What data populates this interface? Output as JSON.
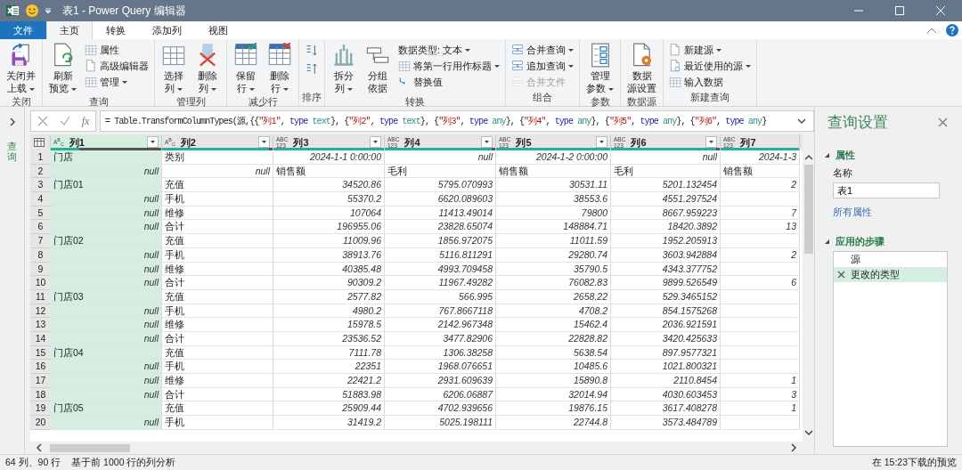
{
  "window": {
    "title": "表1 - Power Query 编辑器"
  },
  "tabs": [
    {
      "label": "文件",
      "kind": "file",
      "selected": false
    },
    {
      "label": "主页",
      "kind": "tab",
      "selected": true
    },
    {
      "label": "转换",
      "kind": "tab",
      "selected": false
    },
    {
      "label": "添加列",
      "kind": "tab",
      "selected": false
    },
    {
      "label": "视图",
      "kind": "tab",
      "selected": false
    }
  ],
  "ribbon": [
    {
      "label": "关闭",
      "items": [
        {
          "kind": "large",
          "lines": [
            "关闭并",
            "上载"
          ],
          "dropdown": true,
          "disabled": false
        }
      ]
    },
    {
      "label": "查询",
      "items": [
        {
          "kind": "large",
          "lines": [
            "刷新",
            "预览"
          ],
          "dropdown": true,
          "disabled": false
        },
        {
          "kind": "small",
          "lines": [
            "属性"
          ],
          "dropdown": false,
          "disabled": false
        },
        {
          "kind": "small",
          "lines": [
            "高级编辑器"
          ],
          "dropdown": false,
          "disabled": false
        },
        {
          "kind": "small",
          "lines": [
            "管理"
          ],
          "dropdown": true,
          "disabled": false
        }
      ]
    },
    {
      "label": "管理列",
      "items": [
        {
          "kind": "large",
          "lines": [
            "选择",
            "列"
          ],
          "dropdown": true,
          "disabled": false
        },
        {
          "kind": "large",
          "lines": [
            "删除",
            "列"
          ],
          "dropdown": true,
          "disabled": false
        }
      ]
    },
    {
      "label": "减少行",
      "items": [
        {
          "kind": "large",
          "lines": [
            "保留",
            "行"
          ],
          "dropdown": true,
          "disabled": false
        },
        {
          "kind": "large",
          "lines": [
            "删除",
            "行"
          ],
          "dropdown": true,
          "disabled": false
        }
      ]
    },
    {
      "label": "排序",
      "items": [
        {
          "kind": "icon",
          "disabled": false
        },
        {
          "kind": "icon",
          "disabled": false
        }
      ]
    },
    {
      "label": "转换",
      "items": [
        {
          "kind": "large",
          "lines": [
            "拆分",
            "列"
          ],
          "dropdown": true,
          "disabled": false
        },
        {
          "kind": "large",
          "lines": [
            "分组",
            "依据"
          ],
          "dropdown": false,
          "disabled": false
        },
        {
          "kind": "small",
          "lines": [
            "数据类型: 文本"
          ],
          "dropdown": true,
          "disabled": false
        },
        {
          "kind": "small",
          "lines": [
            "将第一行用作标题"
          ],
          "dropdown": true,
          "disabled": false
        },
        {
          "kind": "small",
          "lines": [
            "替换值"
          ],
          "dropdown": false,
          "disabled": false
        }
      ]
    },
    {
      "label": "组合",
      "items": [
        {
          "kind": "small",
          "lines": [
            "合并查询"
          ],
          "dropdown": true,
          "disabled": false
        },
        {
          "kind": "small",
          "lines": [
            "追加查询"
          ],
          "dropdown": true,
          "disabled": false
        },
        {
          "kind": "small",
          "lines": [
            "合并文件"
          ],
          "dropdown": false,
          "disabled": true
        }
      ]
    },
    {
      "label": "参数",
      "items": [
        {
          "kind": "large",
          "lines": [
            "管理",
            "参数"
          ],
          "dropdown": true,
          "disabled": false
        }
      ]
    },
    {
      "label": "数据源",
      "items": [
        {
          "kind": "large",
          "lines": [
            "数据",
            "源设置"
          ],
          "dropdown": false,
          "disabled": false
        }
      ]
    },
    {
      "label": "新建查询",
      "items": [
        {
          "kind": "small",
          "lines": [
            "新建源"
          ],
          "dropdown": true,
          "disabled": false
        },
        {
          "kind": "small",
          "lines": [
            "最近使用的源"
          ],
          "dropdown": true,
          "disabled": false
        },
        {
          "kind": "small",
          "lines": [
            "输入数据"
          ],
          "dropdown": false,
          "disabled": false
        }
      ]
    }
  ],
  "navigator": {
    "label": "查询"
  },
  "formula_bar": {
    "fx": "fx",
    "tokens": [
      {
        "t": "= Table.TransformColumnTypes(源,{{",
        "kind": "plain"
      },
      {
        "t": "\"列1\"",
        "kind": "string"
      },
      {
        "t": ", ",
        "kind": "plain"
      },
      {
        "t": "type",
        "kind": "keyword"
      },
      {
        "t": " text",
        "kind": "type"
      },
      {
        "t": "}, {",
        "kind": "plain"
      },
      {
        "t": "\"列2\"",
        "kind": "string"
      },
      {
        "t": ", ",
        "kind": "plain"
      },
      {
        "t": "type",
        "kind": "keyword"
      },
      {
        "t": " text",
        "kind": "type"
      },
      {
        "t": "}, {",
        "kind": "plain"
      },
      {
        "t": "\"列3\"",
        "kind": "string"
      },
      {
        "t": ", ",
        "kind": "plain"
      },
      {
        "t": "type",
        "kind": "keyword"
      },
      {
        "t": " any",
        "kind": "type"
      },
      {
        "t": "}, {",
        "kind": "plain"
      },
      {
        "t": "\"列4\"",
        "kind": "string"
      },
      {
        "t": ", ",
        "kind": "plain"
      },
      {
        "t": "type",
        "kind": "keyword"
      },
      {
        "t": " any",
        "kind": "type"
      },
      {
        "t": "}, {",
        "kind": "plain"
      },
      {
        "t": "\"列5\"",
        "kind": "string"
      },
      {
        "t": ", ",
        "kind": "plain"
      },
      {
        "t": "type",
        "kind": "keyword"
      },
      {
        "t": " any",
        "kind": "type"
      },
      {
        "t": "}, {",
        "kind": "plain"
      },
      {
        "t": "\"列6\"",
        "kind": "string"
      },
      {
        "t": ", ",
        "kind": "plain"
      },
      {
        "t": "type",
        "kind": "keyword"
      },
      {
        "t": " any",
        "kind": "type"
      },
      {
        "t": "}",
        "kind": "plain"
      }
    ]
  },
  "table": {
    "columns": [
      {
        "name": "列1",
        "type_lines": [
          "A$^{B}$$_{C}$"
        ],
        "selected": true,
        "level": 0.26
      },
      {
        "name": "列2",
        "type_lines": [
          "A$^{B}$$_{C}$"
        ],
        "selected": false,
        "level": 0.97
      },
      {
        "name": "列3",
        "type_lines": [
          "ABC",
          "123"
        ],
        "selected": false,
        "level": 1
      },
      {
        "name": "列4",
        "type_lines": [
          "ABC",
          "123"
        ],
        "selected": false,
        "level": 0.97
      },
      {
        "name": "列5",
        "type_lines": [
          "ABC",
          "123"
        ],
        "selected": false,
        "level": 1
      },
      {
        "name": "列6",
        "type_lines": [
          "ABC",
          "123"
        ],
        "selected": false,
        "level": 0.97
      },
      {
        "name": "列7",
        "type_lines": [
          "ABC",
          "123"
        ],
        "selected": false,
        "level": 1
      }
    ],
    "rows": [
      {
        "n": "1",
        "cells": [
          {
            "text": "门店"
          },
          {
            "text": "类别"
          },
          {
            "value": "2024-1-1 0:00:00"
          },
          {
            "value": "null"
          },
          {
            "value": "2024-1-2 0:00:00"
          },
          {
            "value": "null"
          },
          {
            "value": "2024-1-3"
          }
        ]
      },
      {
        "n": "2",
        "cells": [
          {
            "value": "null"
          },
          {
            "value": "null"
          },
          {
            "text": "销售额"
          },
          {
            "text": "毛利"
          },
          {
            "text": "销售额"
          },
          {
            "text": "毛利"
          },
          {
            "text": "销售额"
          }
        ]
      },
      {
        "n": "3",
        "cells": [
          {
            "text": "门店01"
          },
          {
            "text": "充值"
          },
          {
            "value": "34520.86"
          },
          {
            "value": "5795.070993"
          },
          {
            "value": "30531.11"
          },
          {
            "value": "5201.132454"
          },
          {
            "value": "2"
          }
        ]
      },
      {
        "n": "4",
        "cells": [
          {
            "value": "null"
          },
          {
            "text": "手机"
          },
          {
            "value": "55370.2"
          },
          {
            "value": "6620.089603"
          },
          {
            "value": "38553.6"
          },
          {
            "value": "4551.297524"
          }
        ]
      },
      {
        "n": "5",
        "cells": [
          {
            "value": "null"
          },
          {
            "text": "维修"
          },
          {
            "value": "107064"
          },
          {
            "value": "11413.49014"
          },
          {
            "value": "79800"
          },
          {
            "value": "8667.959223"
          },
          {
            "value": "7"
          }
        ]
      },
      {
        "n": "6",
        "cells": [
          {
            "value": "null"
          },
          {
            "text": "合计"
          },
          {
            "value": "196955.06"
          },
          {
            "value": "23828.65074"
          },
          {
            "value": "148884.71"
          },
          {
            "value": "18420.3892"
          },
          {
            "value": "13"
          }
        ]
      },
      {
        "n": "7",
        "cells": [
          {
            "text": "门店02"
          },
          {
            "text": "充值"
          },
          {
            "value": "11009.96"
          },
          {
            "value": "1856.972075"
          },
          {
            "value": "11011.59"
          },
          {
            "value": "1952.205913"
          }
        ]
      },
      {
        "n": "8",
        "cells": [
          {
            "value": "null"
          },
          {
            "text": "手机"
          },
          {
            "value": "38913.76"
          },
          {
            "value": "5116.811291"
          },
          {
            "value": "29280.74"
          },
          {
            "value": "3603.942884"
          },
          {
            "value": "2"
          }
        ]
      },
      {
        "n": "9",
        "cells": [
          {
            "value": "null"
          },
          {
            "text": "维修"
          },
          {
            "value": "40385.48"
          },
          {
            "value": "4993.709458"
          },
          {
            "value": "35790.5"
          },
          {
            "value": "4343.377752"
          }
        ]
      },
      {
        "n": "10",
        "cells": [
          {
            "value": "null"
          },
          {
            "text": "合计"
          },
          {
            "value": "90309.2"
          },
          {
            "value": "11967.49282"
          },
          {
            "value": "76082.83"
          },
          {
            "value": "9899.526549"
          },
          {
            "value": "6"
          }
        ]
      },
      {
        "n": "11",
        "cells": [
          {
            "text": "门店03"
          },
          {
            "text": "充值"
          },
          {
            "value": "2577.82"
          },
          {
            "value": "566.995"
          },
          {
            "value": "2658.22"
          },
          {
            "value": "529.3465152"
          }
        ]
      },
      {
        "n": "12",
        "cells": [
          {
            "value": "null"
          },
          {
            "text": "手机"
          },
          {
            "value": "4980.2"
          },
          {
            "value": "767.8667118"
          },
          {
            "value": "4708.2"
          },
          {
            "value": "854.1575268"
          }
        ]
      },
      {
        "n": "13",
        "cells": [
          {
            "value": "null"
          },
          {
            "text": "维修"
          },
          {
            "value": "15978.5"
          },
          {
            "value": "2142.967348"
          },
          {
            "value": "15462.4"
          },
          {
            "value": "2036.921591"
          }
        ]
      },
      {
        "n": "14",
        "cells": [
          {
            "value": "null"
          },
          {
            "text": "合计"
          },
          {
            "value": "23536.52"
          },
          {
            "value": "3477.82906"
          },
          {
            "value": "22828.82"
          },
          {
            "value": "3420.425633"
          }
        ]
      },
      {
        "n": "15",
        "cells": [
          {
            "text": "门店04"
          },
          {
            "text": "充值"
          },
          {
            "value": "7111.78"
          },
          {
            "value": "1306.38258"
          },
          {
            "value": "5638.54"
          },
          {
            "value": "897.9577321"
          }
        ]
      },
      {
        "n": "16",
        "cells": [
          {
            "value": "null"
          },
          {
            "text": "手机"
          },
          {
            "value": "22351"
          },
          {
            "value": "1968.076651"
          },
          {
            "value": "10485.6"
          },
          {
            "value": "1021.800321"
          }
        ]
      },
      {
        "n": "17",
        "cells": [
          {
            "value": "null"
          },
          {
            "text": "维修"
          },
          {
            "value": "22421.2"
          },
          {
            "value": "2931.609639"
          },
          {
            "value": "15890.8"
          },
          {
            "value": "2110.8454"
          },
          {
            "value": "1"
          }
        ]
      },
      {
        "n": "18",
        "cells": [
          {
            "value": "null"
          },
          {
            "text": "合计"
          },
          {
            "value": "51883.98"
          },
          {
            "value": "6206.06887"
          },
          {
            "value": "32014.94"
          },
          {
            "value": "4030.603453"
          },
          {
            "value": "3"
          }
        ]
      },
      {
        "n": "19",
        "cells": [
          {
            "text": "门店05"
          },
          {
            "text": "充值"
          },
          {
            "value": "25909.44"
          },
          {
            "value": "4702.939656"
          },
          {
            "value": "19876.15"
          },
          {
            "value": "3617.408278"
          },
          {
            "value": "1"
          }
        ]
      },
      {
        "n": "20",
        "cells": [
          {
            "value": "null"
          },
          {
            "text": "手机"
          },
          {
            "value": "31419.2"
          },
          {
            "value": "5025.198111"
          },
          {
            "value": "22744.8"
          },
          {
            "value": "3573.484789"
          }
        ]
      }
    ]
  },
  "settings": {
    "title": "查询设置",
    "sections": [
      {
        "label": "属性",
        "expanded": true
      },
      {
        "label": "应用的步骤",
        "expanded": true
      }
    ],
    "name_label": "名称",
    "name_value": "表1",
    "all_properties": "所有属性",
    "steps": [
      {
        "label": "源",
        "selected": false,
        "deletable": false
      },
      {
        "label": "更改的类型",
        "selected": true,
        "deletable": true
      }
    ]
  },
  "status_bar": {
    "summary": "64 列、90 行",
    "profiling": "基于前 1000 行的列分析",
    "preview": "在 15:23下载的预览"
  }
}
